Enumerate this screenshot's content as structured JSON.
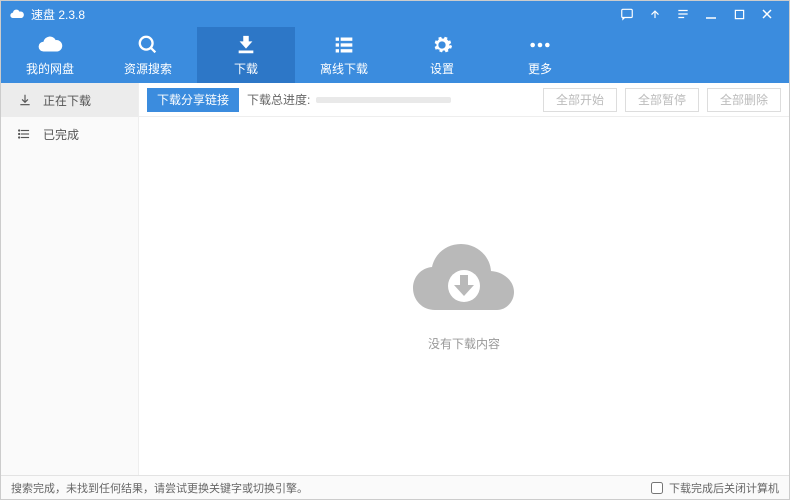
{
  "title": "速盘 2.3.8",
  "nav": [
    {
      "key": "mydisk",
      "label": "我的网盘"
    },
    {
      "key": "search",
      "label": "资源搜索"
    },
    {
      "key": "download",
      "label": "下载"
    },
    {
      "key": "offline",
      "label": "离线下载"
    },
    {
      "key": "settings",
      "label": "设置"
    },
    {
      "key": "more",
      "label": "更多"
    }
  ],
  "sidebar": {
    "downloading": "正在下载",
    "completed": "已完成"
  },
  "toolbar": {
    "share_link_btn": "下载分享链接",
    "progress_label": "下载总进度:",
    "start_all": "全部开始",
    "pause_all": "全部暂停",
    "delete_all": "全部删除"
  },
  "empty_text": "没有下载内容",
  "status": {
    "message": "搜索完成，未找到任何结果，请尝试更换关键字或切换引擎。",
    "shutdown_label": "下载完成后关闭计算机"
  }
}
